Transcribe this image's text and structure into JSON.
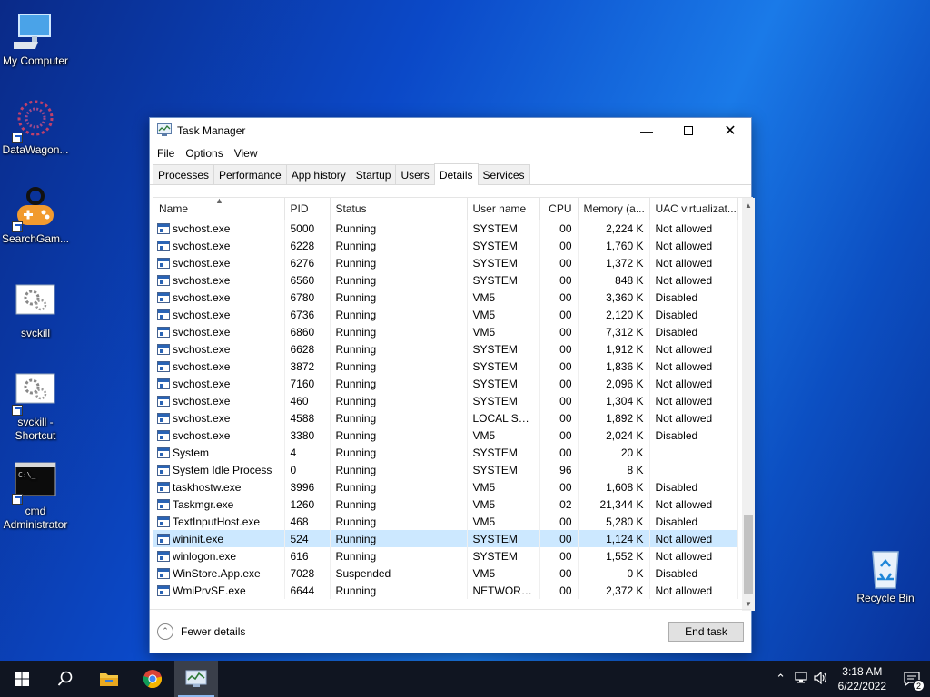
{
  "desktop": {
    "icons": [
      {
        "label": "My Computer",
        "icon": "monitor-icon"
      },
      {
        "label": "DataWagon...",
        "icon": "datawagon-icon"
      },
      {
        "label": "SearchGam...",
        "icon": "gamepad-icon"
      },
      {
        "label": "svckill",
        "icon": "gear-file-icon"
      },
      {
        "label": "svckill - Shortcut",
        "icon": "gear-file-icon"
      },
      {
        "label": "cmd Administrator",
        "icon": "cmd-icon"
      },
      {
        "label": "Recycle Bin",
        "icon": "recycle-bin-icon"
      }
    ]
  },
  "window": {
    "title": "Task Manager",
    "menu": [
      "File",
      "Options",
      "View"
    ],
    "tabs": [
      "Processes",
      "Performance",
      "App history",
      "Startup",
      "Users",
      "Details",
      "Services"
    ],
    "active_tab": "Details",
    "columns": [
      "Name",
      "PID",
      "Status",
      "User name",
      "CPU",
      "Memory (a...",
      "UAC virtualizat..."
    ],
    "rows": [
      [
        "svchost.exe",
        "5000",
        "Running",
        "SYSTEM",
        "00",
        "2,224 K",
        "Not allowed"
      ],
      [
        "svchost.exe",
        "6228",
        "Running",
        "SYSTEM",
        "00",
        "1,760 K",
        "Not allowed"
      ],
      [
        "svchost.exe",
        "6276",
        "Running",
        "SYSTEM",
        "00",
        "1,372 K",
        "Not allowed"
      ],
      [
        "svchost.exe",
        "6560",
        "Running",
        "SYSTEM",
        "00",
        "848 K",
        "Not allowed"
      ],
      [
        "svchost.exe",
        "6780",
        "Running",
        "VM5",
        "00",
        "3,360 K",
        "Disabled"
      ],
      [
        "svchost.exe",
        "6736",
        "Running",
        "VM5",
        "00",
        "2,120 K",
        "Disabled"
      ],
      [
        "svchost.exe",
        "6860",
        "Running",
        "VM5",
        "00",
        "7,312 K",
        "Disabled"
      ],
      [
        "svchost.exe",
        "6628",
        "Running",
        "SYSTEM",
        "00",
        "1,912 K",
        "Not allowed"
      ],
      [
        "svchost.exe",
        "3872",
        "Running",
        "SYSTEM",
        "00",
        "1,836 K",
        "Not allowed"
      ],
      [
        "svchost.exe",
        "7160",
        "Running",
        "SYSTEM",
        "00",
        "2,096 K",
        "Not allowed"
      ],
      [
        "svchost.exe",
        "460",
        "Running",
        "SYSTEM",
        "00",
        "1,304 K",
        "Not allowed"
      ],
      [
        "svchost.exe",
        "4588",
        "Running",
        "LOCAL SE...",
        "00",
        "1,892 K",
        "Not allowed"
      ],
      [
        "svchost.exe",
        "3380",
        "Running",
        "VM5",
        "00",
        "2,024 K",
        "Disabled"
      ],
      [
        "System",
        "4",
        "Running",
        "SYSTEM",
        "00",
        "20 K",
        ""
      ],
      [
        "System Idle Process",
        "0",
        "Running",
        "SYSTEM",
        "96",
        "8 K",
        ""
      ],
      [
        "taskhostw.exe",
        "3996",
        "Running",
        "VM5",
        "00",
        "1,608 K",
        "Disabled"
      ],
      [
        "Taskmgr.exe",
        "1260",
        "Running",
        "VM5",
        "02",
        "21,344 K",
        "Not allowed"
      ],
      [
        "TextInputHost.exe",
        "468",
        "Running",
        "VM5",
        "00",
        "5,280 K",
        "Disabled"
      ],
      [
        "wininit.exe",
        "524",
        "Running",
        "SYSTEM",
        "00",
        "1,124 K",
        "Not allowed"
      ],
      [
        "winlogon.exe",
        "616",
        "Running",
        "SYSTEM",
        "00",
        "1,552 K",
        "Not allowed"
      ],
      [
        "WinStore.App.exe",
        "7028",
        "Suspended",
        "VM5",
        "00",
        "0 K",
        "Disabled"
      ],
      [
        "WmiPrvSE.exe",
        "6644",
        "Running",
        "NETWORK...",
        "00",
        "2,372 K",
        "Not allowed"
      ]
    ],
    "selected_row": 18,
    "footer": {
      "fewer_details": "Fewer details",
      "end_task": "End task"
    }
  },
  "taskbar": {
    "apps": [
      "windows-start-icon",
      "search-icon",
      "file-explorer-icon",
      "chrome-icon",
      "task-manager-icon"
    ],
    "clock_time": "3:18 AM",
    "clock_date": "6/22/2022",
    "notification_count": "2"
  }
}
